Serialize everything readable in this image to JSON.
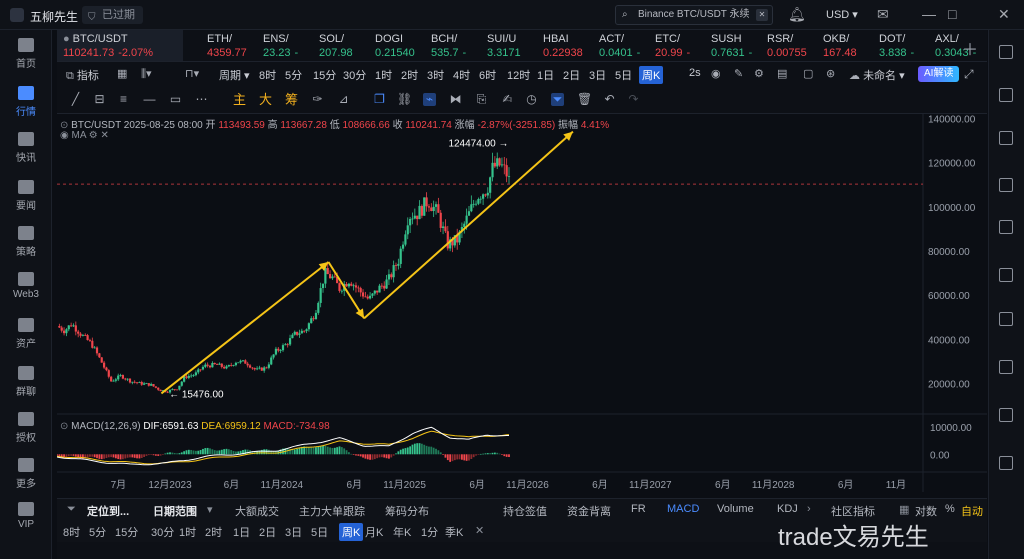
{
  "app": {
    "title": "五柳先生",
    "expired_label": "已过期"
  },
  "top": {
    "search_text": "Binance BTC/USDT 永续",
    "currency": "USD"
  },
  "tickers": [
    {
      "sym": "BTC/USDT",
      "price": "110241.73",
      "change": "-2.07%",
      "dir": "down",
      "active": true
    },
    {
      "sym": "ETH/",
      "price": "4359.77",
      "change": "",
      "dir": "down"
    },
    {
      "sym": "ENS/",
      "price": "23.23",
      "change": "-",
      "dir": "up"
    },
    {
      "sym": "SOL/",
      "price": "207.98",
      "change": "",
      "dir": "up"
    },
    {
      "sym": "DOGI",
      "price": "0.21540",
      "change": "",
      "dir": "up"
    },
    {
      "sym": "BCH/",
      "price": "535.7",
      "change": "-",
      "dir": "up"
    },
    {
      "sym": "SUI/U",
      "price": "3.3171",
      "change": "",
      "dir": "up"
    },
    {
      "sym": "HBAI",
      "price": "0.22938",
      "change": "",
      "dir": "down"
    },
    {
      "sym": "ACT/",
      "price": "0.0401",
      "change": "-",
      "dir": "up"
    },
    {
      "sym": "ETC/",
      "price": "20.99",
      "change": "-",
      "dir": "down"
    },
    {
      "sym": "SUSH",
      "price": "0.7631",
      "change": "-",
      "dir": "up"
    },
    {
      "sym": "RSR/",
      "price": "0.00755",
      "change": "",
      "dir": "down"
    },
    {
      "sym": "OKB/",
      "price": "167.48",
      "change": "",
      "dir": "down"
    },
    {
      "sym": "DOT/",
      "price": "3.838",
      "change": "-",
      "dir": "up"
    },
    {
      "sym": "AXL/",
      "price": "0.3043",
      "change": "-",
      "dir": "up"
    }
  ],
  "sidebar": [
    {
      "label": "首页",
      "icon": "home-icon"
    },
    {
      "label": "行情",
      "icon": "market-icon",
      "active": true
    },
    {
      "label": "快讯",
      "icon": "news-flash-icon"
    },
    {
      "label": "要闻",
      "icon": "headlines-icon"
    },
    {
      "label": "策略",
      "icon": "strategy-icon"
    },
    {
      "label": "Web3",
      "icon": "web3-icon"
    },
    {
      "label": "资产",
      "icon": "assets-icon"
    },
    {
      "label": "群聊",
      "icon": "group-chat-icon"
    },
    {
      "label": "授权",
      "icon": "authorize-icon"
    },
    {
      "label": "更多",
      "icon": "more-icon"
    },
    {
      "label": "VIP",
      "icon": "vip-icon"
    }
  ],
  "toolbar1": {
    "indicator": "指标",
    "period": "周期",
    "periods": [
      "8时",
      "5分",
      "15分",
      "30分",
      "1时",
      "2时",
      "3时",
      "4时",
      "6时",
      "12时",
      "1日",
      "2日",
      "3日",
      "5日",
      "周K"
    ],
    "active_period": "周K",
    "speed": "2s",
    "unnamed": "未命名",
    "ai_label": "AI解读"
  },
  "toolbar2": {
    "labels": [
      "主",
      "大",
      "筹"
    ]
  },
  "chart_header": {
    "symbol": "BTC/USDT",
    "date": "2025-08-25 08:00",
    "open_label": "开",
    "open": "113493.59",
    "high_label": "高",
    "high": "113667.28",
    "low_label": "低",
    "low": "108666.66",
    "close_label": "收",
    "close": "110241.74",
    "chg_label": "涨幅",
    "chg": "-2.87%(-3251.85)",
    "amp_label": "振幅",
    "amp": "4.41%",
    "ma_label": "MA"
  },
  "macd_header": {
    "label": "MACD(12,26,9)",
    "dif_label": "DIF:",
    "dif": "6591.63",
    "dea_label": "DEA:",
    "dea": "6959.12",
    "macd_label": "MACD:",
    "macd": "-734.98"
  },
  "chart_data": {
    "type": "line",
    "title": "BTC/USDT",
    "y_ticks": [
      "140000.00",
      "120000.00",
      "100000.00",
      "80000.00",
      "60000.00",
      "40000.00",
      "20000.00"
    ],
    "y_tick_values": [
      140000,
      120000,
      100000,
      80000,
      60000,
      40000,
      20000
    ],
    "macd_ticks": [
      "10000.00",
      "0.00"
    ],
    "macd_tick_values": [
      10000,
      0
    ],
    "x_ticks": [
      "7月",
      "12月2023",
      "6月",
      "11月2024",
      "6月",
      "11月2025",
      "6月",
      "11月2026",
      "6月",
      "11月2027",
      "6月",
      "11月2028",
      "6月",
      "11月"
    ],
    "x_tick_times": [
      2022.5,
      2022.92,
      2023.42,
      2023.83,
      2024.42,
      2024.83,
      2025.42,
      2025.83,
      2026.42,
      2026.83,
      2027.42,
      2027.83,
      2028.42,
      2028.83
    ],
    "x_range": [
      2022.0,
      2029.05
    ],
    "y_range": [
      8000,
      142000
    ],
    "last_price": 110241.74,
    "annotations": [
      {
        "text": "124474.00",
        "x": 2025.61,
        "y": 124474
      },
      {
        "text": "15476.00",
        "x": 2022.88,
        "y": 15476
      }
    ],
    "trend_lines": [
      {
        "from": [
          2022.85,
          15500
        ],
        "to": [
          2024.21,
          75000
        ]
      },
      {
        "from": [
          2024.21,
          75000
        ],
        "to": [
          2024.5,
          49500
        ]
      },
      {
        "from": [
          2024.5,
          49500
        ],
        "to": [
          2026.2,
          134000
        ]
      }
    ],
    "series": [
      {
        "price_points": [
          [
            2022.0,
            46000
          ],
          [
            2022.06,
            44000
          ],
          [
            2022.12,
            47000
          ],
          [
            2022.2,
            42000
          ],
          [
            2022.28,
            38000
          ],
          [
            2022.36,
            30000
          ],
          [
            2022.44,
            21000
          ],
          [
            2022.52,
            23500
          ],
          [
            2022.6,
            21000
          ],
          [
            2022.68,
            20000
          ],
          [
            2022.76,
            19500
          ],
          [
            2022.84,
            17000
          ],
          [
            2022.9,
            16500
          ],
          [
            2022.98,
            17800
          ],
          [
            2023.04,
            23000
          ],
          [
            2023.12,
            24000
          ],
          [
            2023.2,
            28000
          ],
          [
            2023.3,
            28500
          ],
          [
            2023.38,
            27000
          ],
          [
            2023.46,
            30000
          ],
          [
            2023.54,
            29500
          ],
          [
            2023.62,
            26000
          ],
          [
            2023.7,
            27000
          ],
          [
            2023.78,
            34500
          ],
          [
            2023.86,
            37500
          ],
          [
            2023.94,
            42500
          ],
          [
            2024.02,
            44000
          ],
          [
            2024.1,
            52000
          ],
          [
            2024.18,
            70000
          ],
          [
            2024.24,
            68000
          ],
          [
            2024.3,
            63000
          ],
          [
            2024.38,
            67000
          ],
          [
            2024.46,
            62000
          ],
          [
            2024.54,
            58000
          ],
          [
            2024.62,
            63000
          ],
          [
            2024.7,
            67000
          ],
          [
            2024.78,
            76000
          ],
          [
            2024.86,
            96000
          ],
          [
            2024.94,
            97000
          ],
          [
            2025.02,
            103000
          ],
          [
            2025.1,
            97000
          ],
          [
            2025.18,
            83000
          ],
          [
            2025.26,
            85000
          ],
          [
            2025.34,
            95000
          ],
          [
            2025.42,
            105000
          ],
          [
            2025.5,
            108000
          ],
          [
            2025.55,
            118000
          ],
          [
            2025.61,
            119000
          ],
          [
            2025.66,
            115000
          ],
          [
            2025.69,
            110200
          ]
        ]
      }
    ],
    "macd": {
      "dif": [
        [
          2022.0,
          -800
        ],
        [
          2022.3,
          -2500
        ],
        [
          2022.6,
          -3800
        ],
        [
          2022.9,
          -3200
        ],
        [
          2023.2,
          -900
        ],
        [
          2023.5,
          300
        ],
        [
          2023.8,
          1500
        ],
        [
          2024.1,
          4200
        ],
        [
          2024.3,
          5800
        ],
        [
          2024.5,
          3200
        ],
        [
          2024.7,
          2800
        ],
        [
          2024.9,
          7800
        ],
        [
          2025.05,
          9600
        ],
        [
          2025.2,
          6200
        ],
        [
          2025.35,
          5200
        ],
        [
          2025.5,
          7200
        ],
        [
          2025.69,
          6591
        ]
      ],
      "dea": [
        [
          2022.0,
          -500
        ],
        [
          2022.3,
          -1900
        ],
        [
          2022.6,
          -3100
        ],
        [
          2022.9,
          -3300
        ],
        [
          2023.2,
          -1800
        ],
        [
          2023.5,
          -300
        ],
        [
          2023.8,
          800
        ],
        [
          2024.1,
          2900
        ],
        [
          2024.3,
          4600
        ],
        [
          2024.5,
          4000
        ],
        [
          2024.7,
          3400
        ],
        [
          2024.9,
          6000
        ],
        [
          2025.05,
          8200
        ],
        [
          2025.2,
          7300
        ],
        [
          2025.35,
          6100
        ],
        [
          2025.5,
          6800
        ],
        [
          2025.69,
          6959
        ]
      ]
    },
    "colors": {
      "up": "#35c28c",
      "down": "#f0454b",
      "trend": "#f5c417",
      "dif": "#ffffff",
      "dea": "#f5c417"
    }
  },
  "bottom_tabs": [
    {
      "label": "定位到...",
      "bold": true
    },
    {
      "label": "日期范围",
      "bold": true
    },
    {
      "label": "大额成交"
    },
    {
      "label": "主力大单跟踪"
    },
    {
      "label": "筹码分布"
    },
    {
      "label": "持仓签值"
    },
    {
      "label": "资金背离"
    },
    {
      "label": "FR"
    },
    {
      "label": "MACD",
      "active": true
    },
    {
      "label": "Volume"
    },
    {
      "label": "KDJ"
    },
    {
      "label": "社区指标"
    },
    {
      "label": "对数"
    },
    {
      "label": "%"
    },
    {
      "label": "自动",
      "active_yellow": true
    }
  ],
  "bottom_periods": [
    "8时",
    "5分",
    "15分",
    "30分",
    "1时",
    "2时",
    "1日",
    "2日",
    "3日",
    "5日",
    "周K",
    "月K",
    "年K",
    "1分",
    "季K"
  ],
  "watermark": "trade文易先生"
}
